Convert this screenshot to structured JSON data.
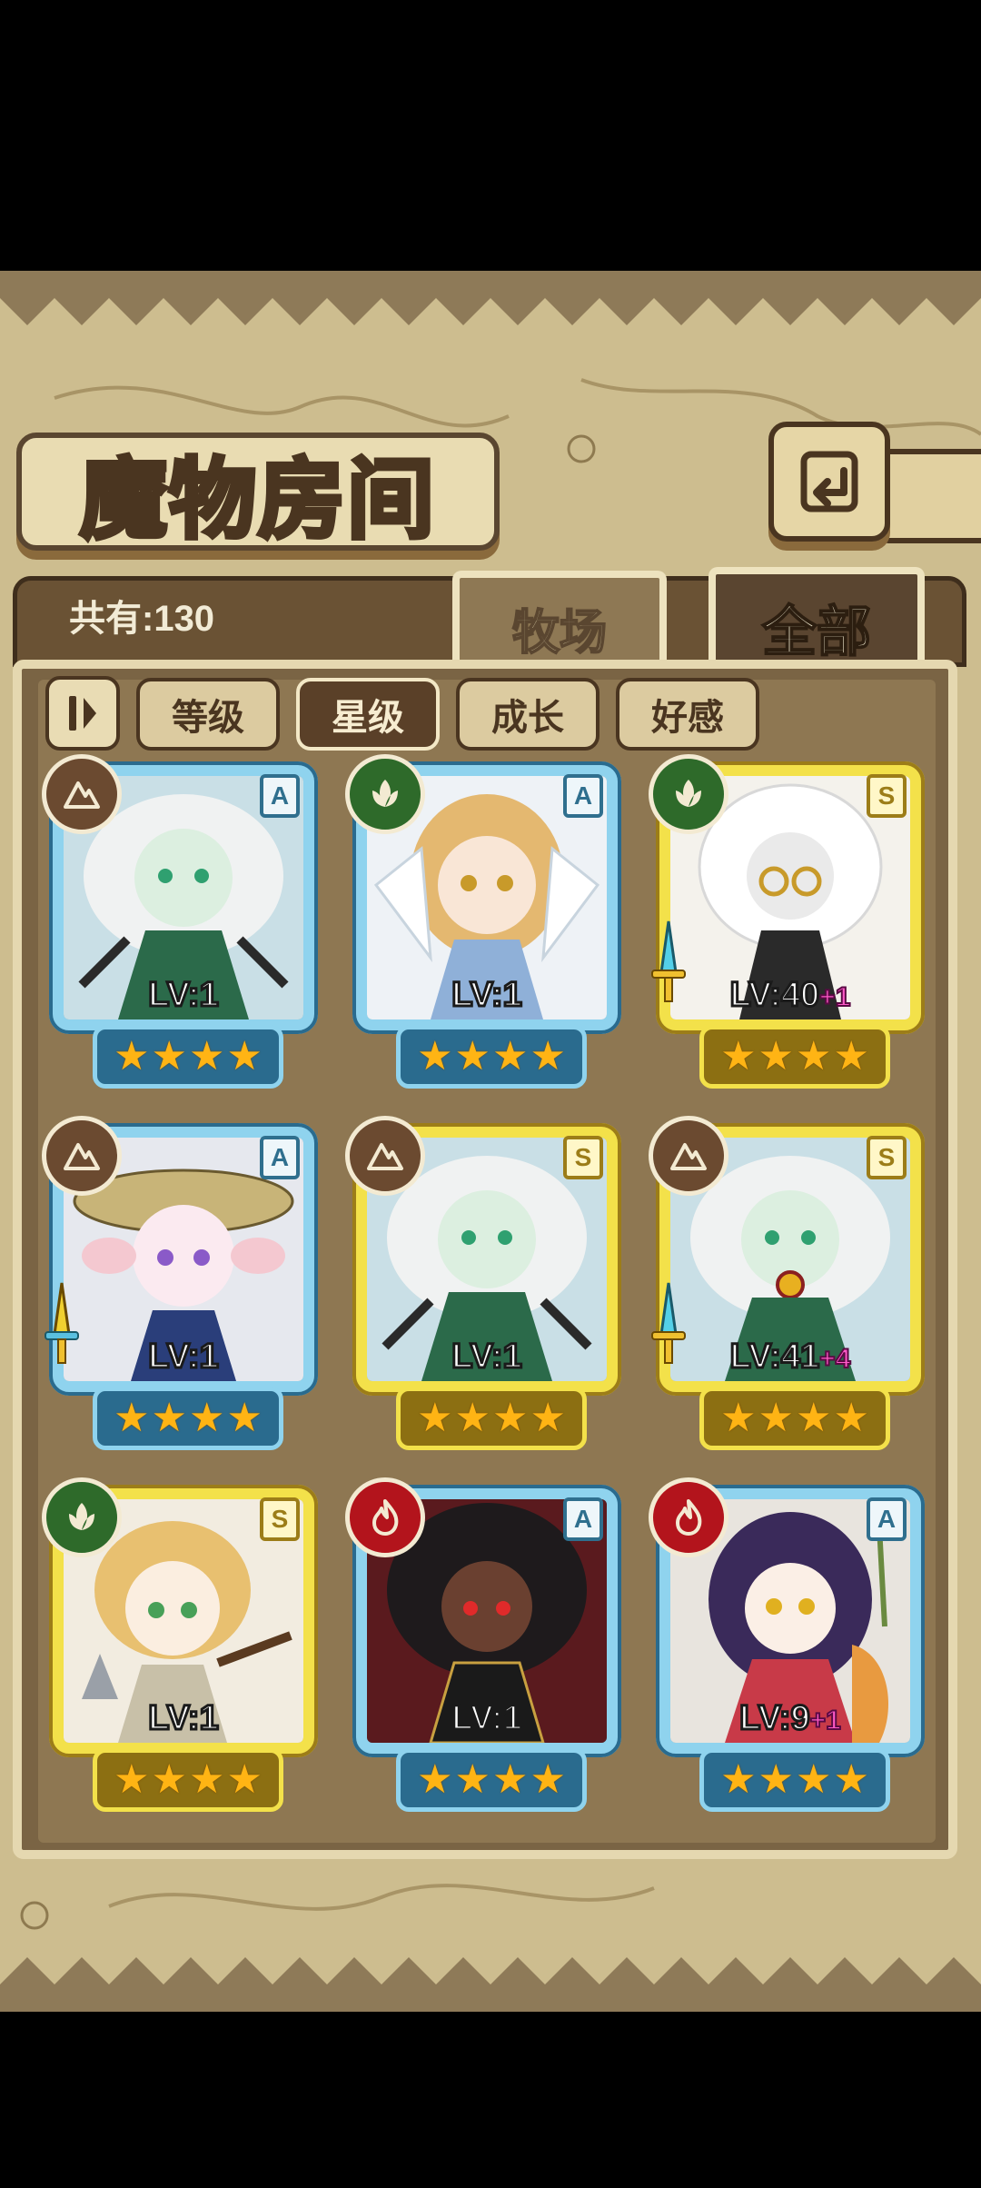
{
  "header": {
    "title": "魔物房间"
  },
  "summary": {
    "count_text": "共有:130"
  },
  "tabs": [
    {
      "label": "牧场",
      "active": false
    },
    {
      "label": "全部",
      "active": true
    }
  ],
  "filters": [
    {
      "label": "等级",
      "active": false
    },
    {
      "label": "星级",
      "active": true
    },
    {
      "label": "成长",
      "active": false
    },
    {
      "label": "好感",
      "active": false
    }
  ],
  "cards": [
    {
      "level": "LV:1",
      "bonus": "",
      "rank": "A",
      "element": "earth",
      "stars": 4,
      "equipped": false
    },
    {
      "level": "LV:1",
      "bonus": "",
      "rank": "A",
      "element": "nature",
      "stars": 4,
      "equipped": false
    },
    {
      "level": "LV:40",
      "bonus": "+1",
      "rank": "S",
      "element": "nature",
      "stars": 4,
      "equipped": true
    },
    {
      "level": "LV:1",
      "bonus": "",
      "rank": "A",
      "element": "earth",
      "stars": 4,
      "equipped": true
    },
    {
      "level": "LV:1",
      "bonus": "",
      "rank": "S",
      "element": "earth",
      "stars": 4,
      "equipped": false
    },
    {
      "level": "LV:41",
      "bonus": "+4",
      "rank": "S",
      "element": "earth",
      "stars": 4,
      "equipped": true
    },
    {
      "level": "LV:1",
      "bonus": "",
      "rank": "S",
      "element": "nature",
      "stars": 4,
      "equipped": false
    },
    {
      "level": "LV:1",
      "bonus": "",
      "rank": "A",
      "element": "fire",
      "stars": 4,
      "equipped": false
    },
    {
      "level": "LV:9",
      "bonus": "+1",
      "rank": "A",
      "element": "fire",
      "stars": 4,
      "equipped": false
    }
  ],
  "colors": {
    "frame_a": "#8fd3ee",
    "frame_s": "#f3e14a",
    "star": "#ffb414",
    "bonus": "#ff5ac8"
  }
}
